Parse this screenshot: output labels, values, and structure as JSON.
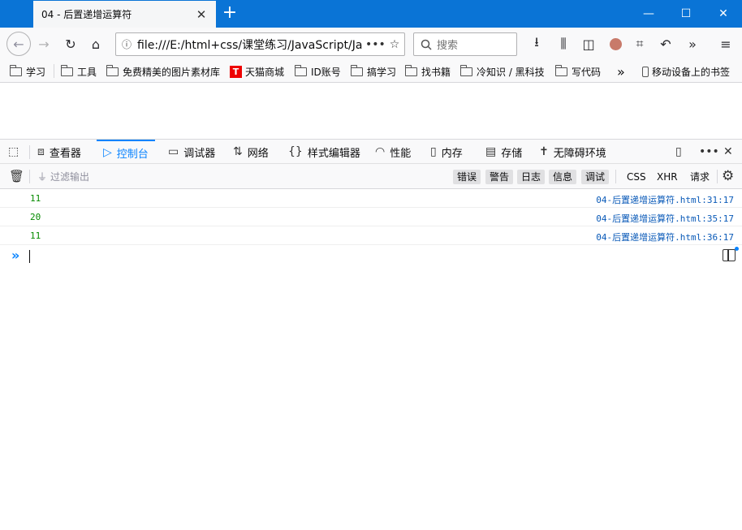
{
  "browser": {
    "tab_title": "04 - 后置递增运算符",
    "url": "file:///E:/html+css/课堂练习/JavaScript/Ja",
    "search_placeholder": "搜索"
  },
  "bookmarks": [
    "学习",
    "工具",
    "免费精美的图片素材库",
    "天猫商城",
    "ID账号",
    "搞学习",
    "找书籍",
    "冷知识 / 黑科技",
    "写代码",
    "移动设备上的书签"
  ],
  "devtools": {
    "tabs": [
      "查看器",
      "控制台",
      "调试器",
      "网络",
      "样式编辑器",
      "性能",
      "内存",
      "存储",
      "无障碍环境"
    ],
    "active_tab": "控制台",
    "filter_placeholder": "过滤输出",
    "filter_buttons": [
      "错误",
      "警告",
      "日志",
      "信息",
      "调试"
    ],
    "filter_plain": [
      "CSS",
      "XHR",
      "请求"
    ]
  },
  "console": {
    "messages": [
      {
        "value": "11",
        "source": "04-后置递增运算符.html:31:17"
      },
      {
        "value": "20",
        "source": "04-后置递增运算符.html:35:17"
      },
      {
        "value": "11",
        "source": "04-后置递增运算符.html:36:17"
      }
    ],
    "prompt_symbol": "»"
  },
  "colors": {
    "titlebar": "#0a74d6",
    "accent": "#0a84ff",
    "log_value": "#058b00",
    "source_link": "#0a5ab8"
  }
}
